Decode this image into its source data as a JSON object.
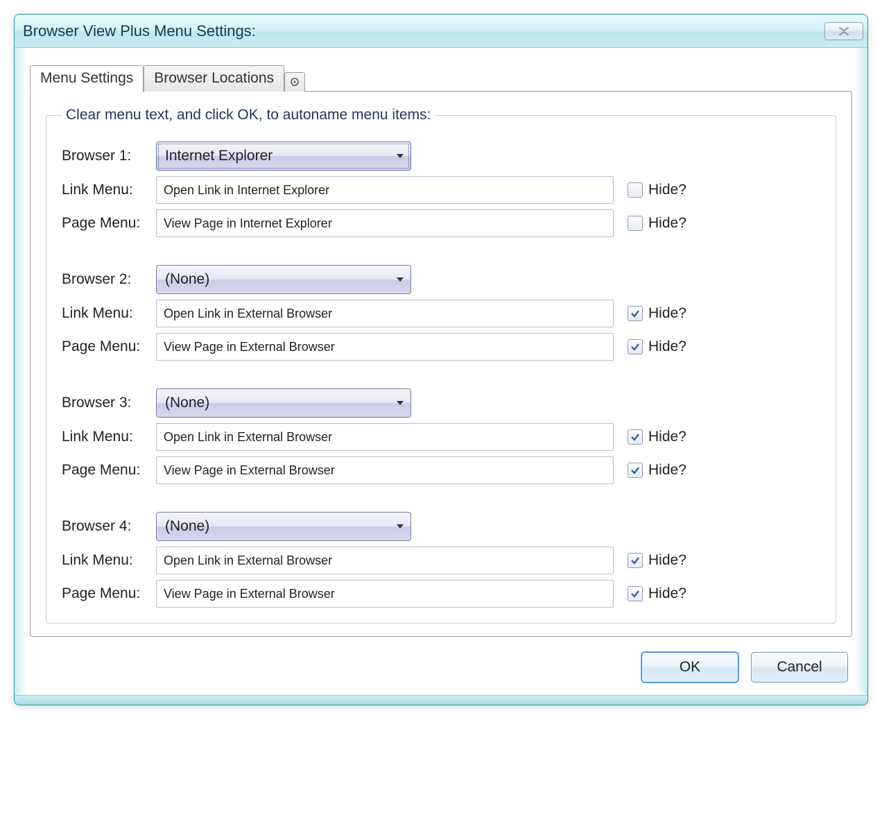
{
  "window": {
    "title": "Browser View Plus Menu Settings:"
  },
  "tabs": {
    "items": [
      {
        "label": "Menu Settings",
        "active": true
      },
      {
        "label": "Browser Locations",
        "active": false
      }
    ],
    "overflow_icon": "options-icon"
  },
  "group": {
    "legend": "Clear menu text, and click OK, to autoname menu items:"
  },
  "labels": {
    "browser_prefix": "Browser",
    "link_menu": "Link Menu:",
    "page_menu": "Page Menu:",
    "hide": "Hide?"
  },
  "browsers": [
    {
      "label": "Browser 1:",
      "selected": "Internet Explorer",
      "focused": true,
      "link_menu": "Open Link in Internet Explorer",
      "link_hide": false,
      "page_menu": "View Page in Internet Explorer",
      "page_hide": false
    },
    {
      "label": "Browser 2:",
      "selected": "(None)",
      "focused": false,
      "link_menu": "Open Link in External Browser",
      "link_hide": true,
      "page_menu": "View Page in External Browser",
      "page_hide": true
    },
    {
      "label": "Browser 3:",
      "selected": "(None)",
      "focused": false,
      "link_menu": "Open Link in External Browser",
      "link_hide": true,
      "page_menu": "View Page in External Browser",
      "page_hide": true
    },
    {
      "label": "Browser 4:",
      "selected": "(None)",
      "focused": false,
      "link_menu": "Open Link in External Browser",
      "link_hide": true,
      "page_menu": "View Page in External Browser",
      "page_hide": true
    }
  ],
  "buttons": {
    "ok": "OK",
    "cancel": "Cancel"
  }
}
